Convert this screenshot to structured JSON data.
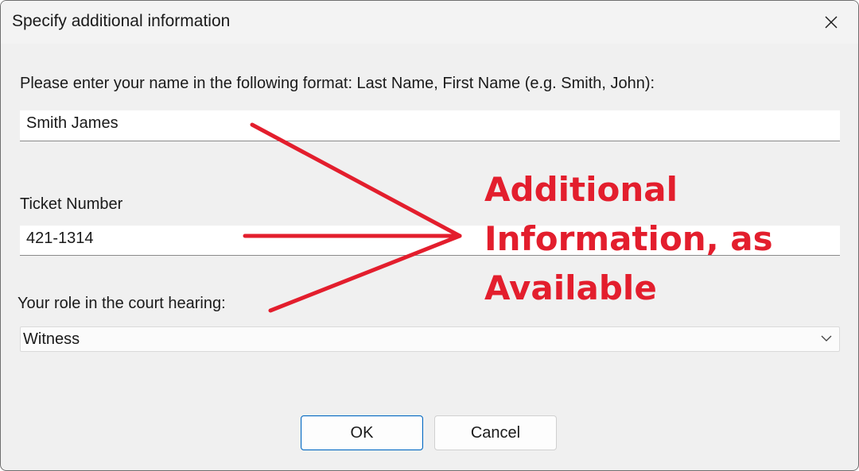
{
  "dialog": {
    "title": "Specify additional information",
    "close_glyph": "close-icon"
  },
  "form": {
    "name_label": "Please enter your name in the following format: Last Name, First Name (e.g. Smith, John):",
    "name_value": "Smith James",
    "ticket_label": "Ticket Number",
    "ticket_value": "421-1314",
    "role_label": "Your role in the court hearing:",
    "role_selected": "Witness"
  },
  "buttons": {
    "ok": "OK",
    "cancel": "Cancel"
  },
  "annotation": {
    "lines": [
      "Additional",
      "Information, as",
      "Available"
    ],
    "color": "#e31e2d"
  },
  "colors": {
    "accent": "#0067c0",
    "dialog_bg": "#f0f0f0"
  }
}
